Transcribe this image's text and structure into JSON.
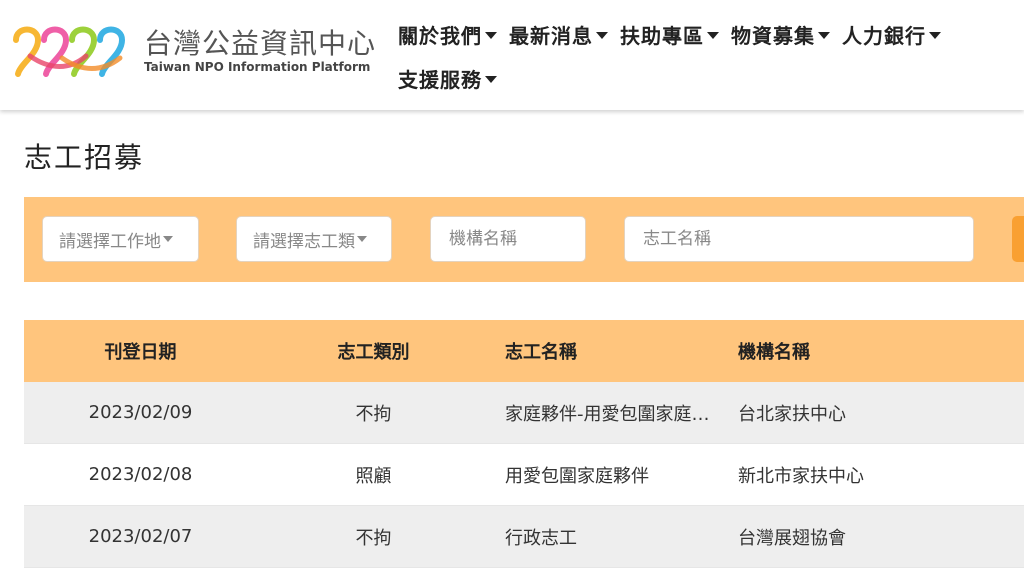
{
  "header": {
    "logo_cn": "台灣公益資訊中心",
    "logo_en": "Taiwan NPO Information Platform",
    "nav_row1": [
      "關於我們",
      "最新消息",
      "扶助專區",
      "物資募集",
      "人力銀行"
    ],
    "nav_row2": [
      "支援服務"
    ]
  },
  "page": {
    "title": "志工招募"
  },
  "filters": {
    "work_select": "請選擇工作地",
    "type_select": "請選擇志工類",
    "org_placeholder": "機構名稱",
    "volunteer_placeholder": "志工名稱"
  },
  "table": {
    "headers": [
      "刊登日期",
      "志工類別",
      "志工名稱",
      "機構名稱"
    ],
    "rows": [
      {
        "date": "2023/02/09",
        "type": "不拘",
        "name": "家庭夥伴-用愛包圍家庭夥伴",
        "org": "台北家扶中心"
      },
      {
        "date": "2023/02/08",
        "type": "照顧",
        "name": "用愛包圍家庭夥伴",
        "org": "新北市家扶中心"
      },
      {
        "date": "2023/02/07",
        "type": "不拘",
        "name": "行政志工",
        "org": "台灣展翅協會"
      }
    ]
  },
  "colors": {
    "accent": "#ffc57d",
    "button": "#f9a032"
  }
}
